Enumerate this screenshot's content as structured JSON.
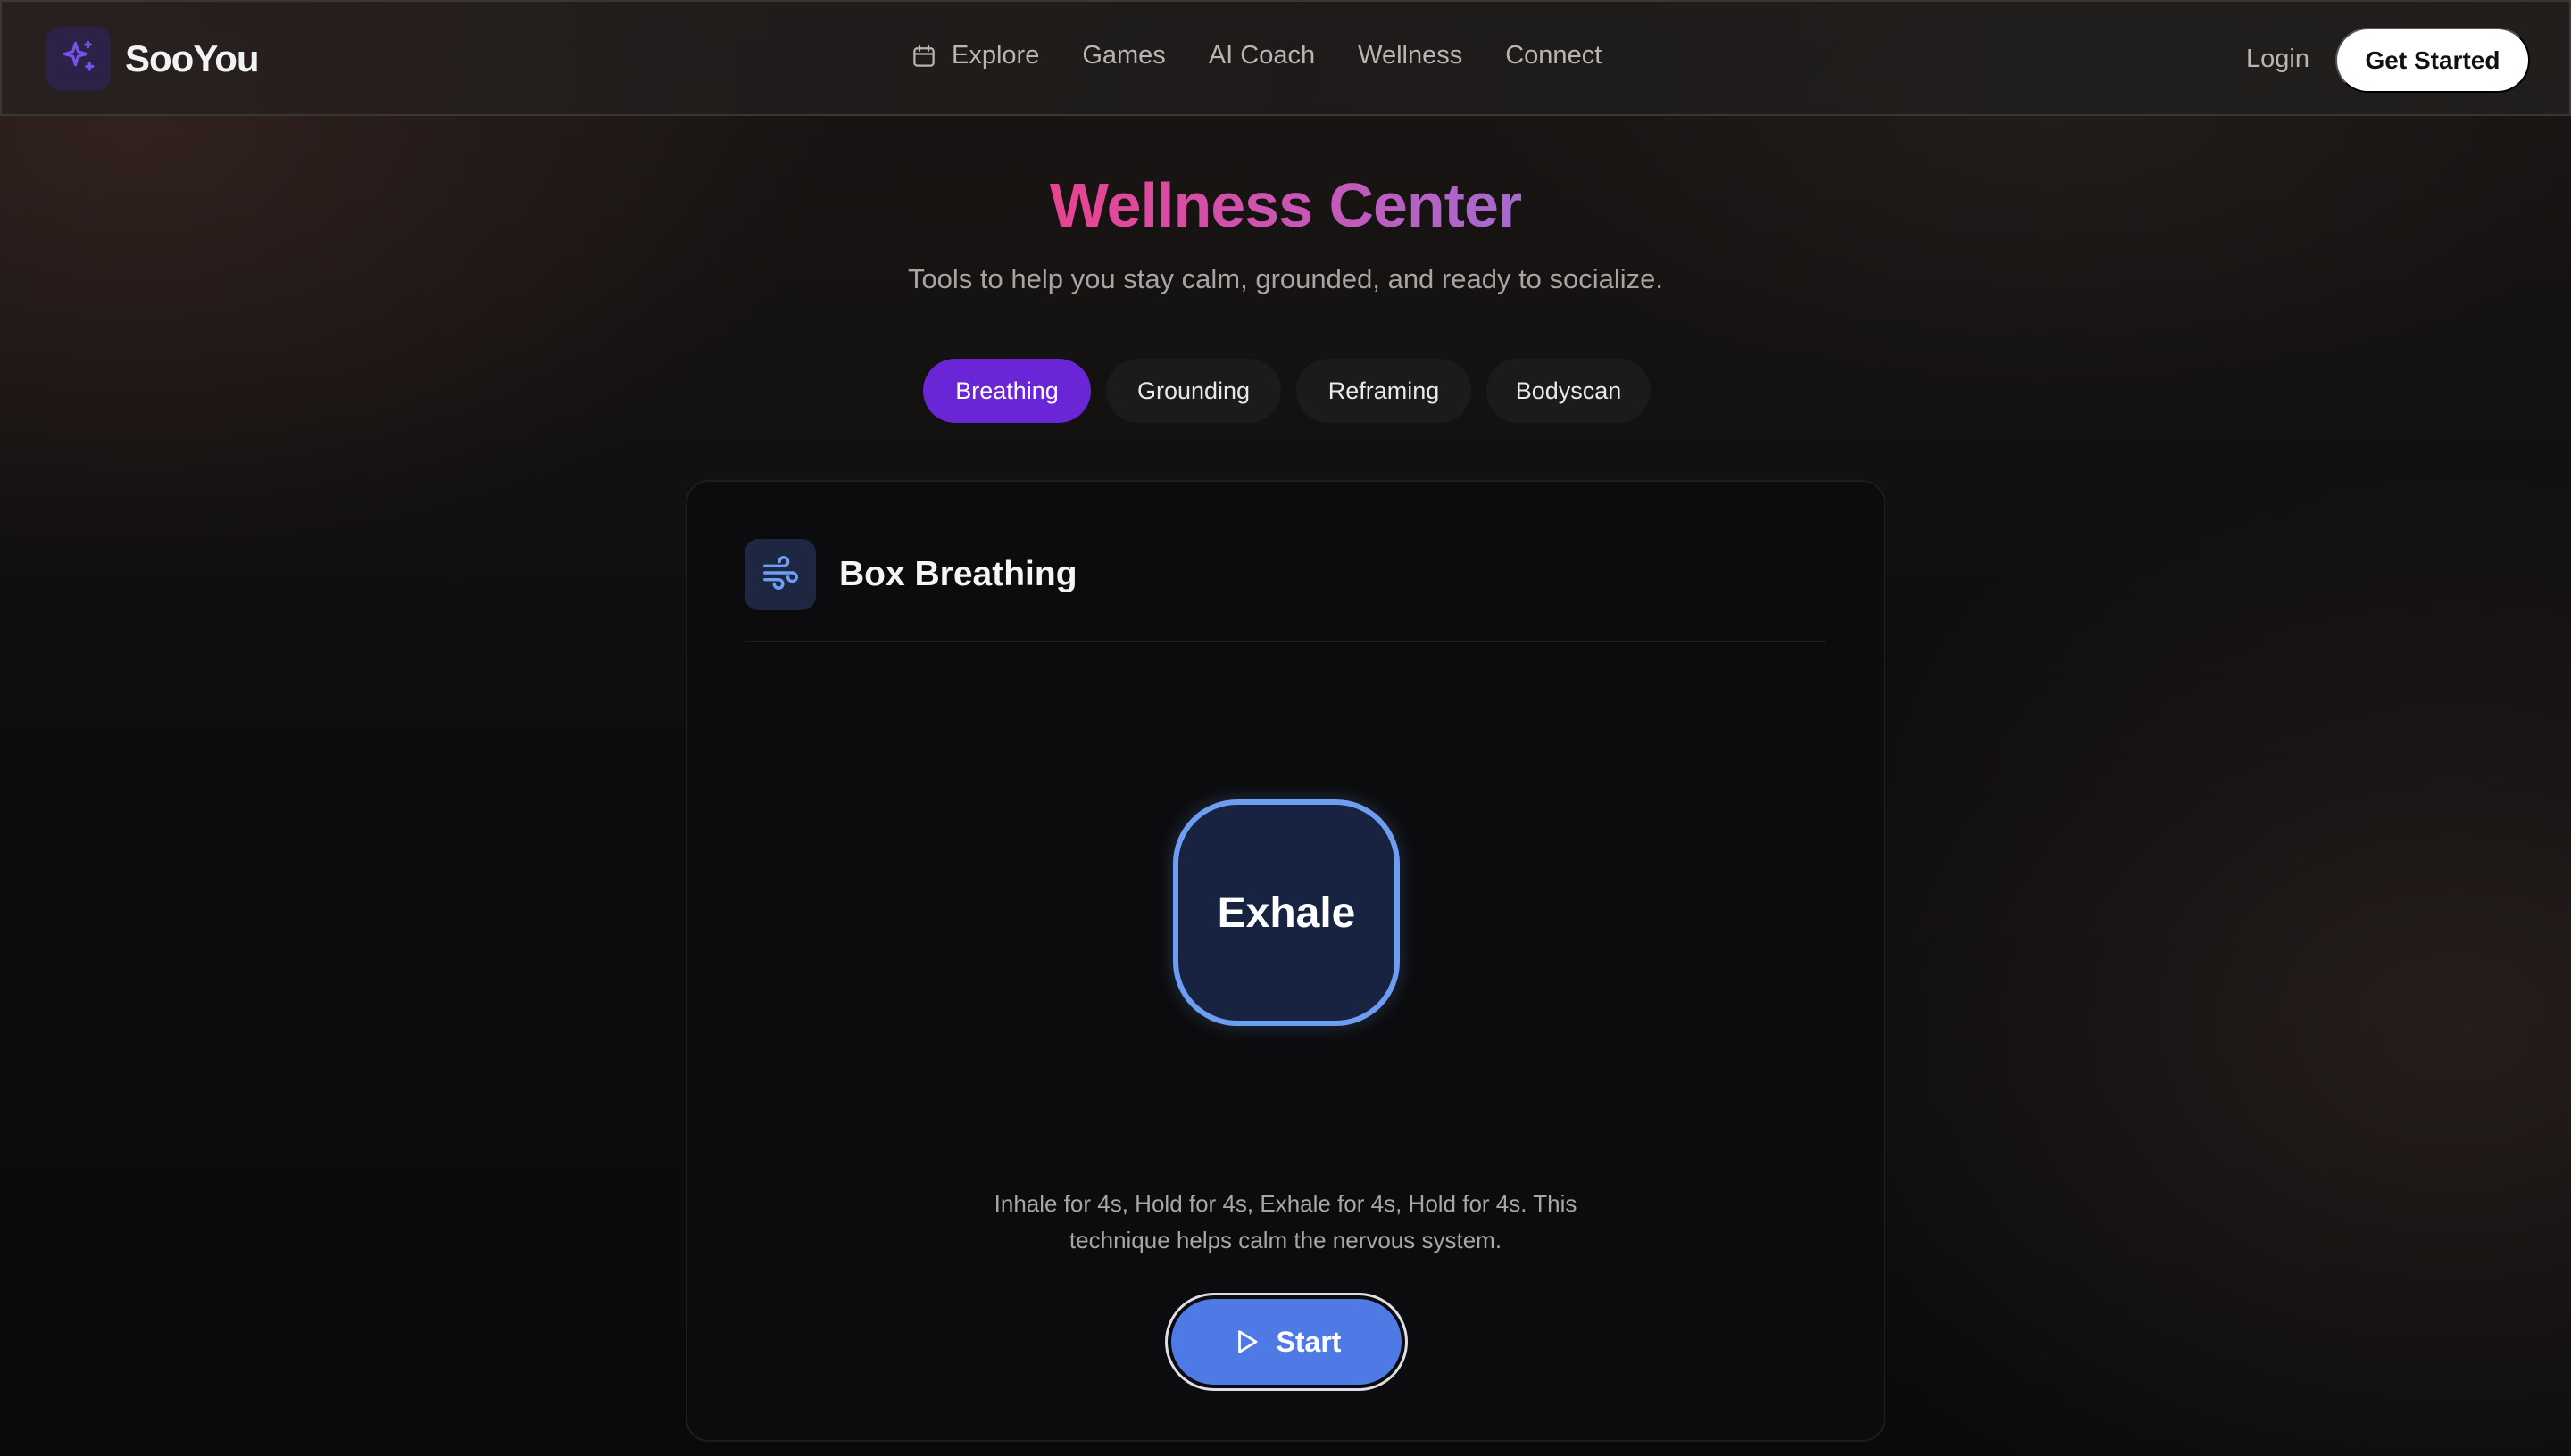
{
  "brand": {
    "name": "SooYou",
    "logo_icon": "sparkles-icon"
  },
  "nav": {
    "items": [
      {
        "label": "Explore",
        "icon": "calendar-icon"
      },
      {
        "label": "Games"
      },
      {
        "label": "AI Coach"
      },
      {
        "label": "Wellness"
      },
      {
        "label": "Connect"
      }
    ],
    "login": "Login",
    "cta": "Get Started"
  },
  "header": {
    "title": "Wellness Center",
    "subtitle": "Tools to help you stay calm, grounded, and ready to socialize."
  },
  "tabs": [
    {
      "label": "Breathing",
      "active": true
    },
    {
      "label": "Grounding",
      "active": false
    },
    {
      "label": "Reframing",
      "active": false
    },
    {
      "label": "Bodyscan",
      "active": false
    }
  ],
  "exercise": {
    "icon": "wind-icon",
    "title": "Box Breathing",
    "phase": "Exhale",
    "description": "Inhale for 4s, Hold for 4s, Exhale for 4s, Hold for 4s. This technique helps calm the nervous system.",
    "start_label": "Start",
    "start_icon": "play-icon"
  },
  "colors": {
    "accent_purple": "#6a26d6",
    "title_gradient_start": "#e8438f",
    "title_gradient_end": "#a56ad0",
    "breath_border": "#6e9ef2",
    "start_button": "#4f7ae6"
  }
}
